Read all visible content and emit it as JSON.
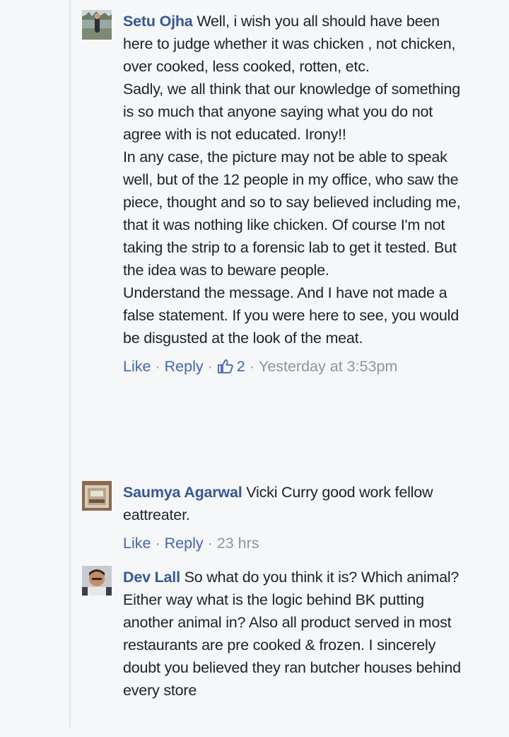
{
  "comments": [
    {
      "author": "Setu Ojha",
      "text": "Well, i wish you all should have been here to judge whether it was chicken , not chicken, over cooked, less cooked, rotten, etc.\nSadly, we all think that our knowledge of something is so much that anyone saying what you do not agree with is not educated. Irony!!\nIn any case, the picture may not be able to speak well, but of the 12 people in my office, who saw the piece, thought and so to say believed including me, that it was nothing like chicken. Of course I'm not taking the strip to a forensic lab to get it tested. But the idea was to beware people.\nUnderstand the message. And I have not made a false statement. If you were here to see, you would be disgusted at the look of the meat.",
      "like_label": "Like",
      "reply_label": "Reply",
      "like_count": "2",
      "timestamp": "Yesterday at 3:53pm"
    },
    {
      "author": "Saumya Agarwal",
      "text": "Vicki Curry good work fellow eattreater.",
      "like_label": "Like",
      "reply_label": "Reply",
      "timestamp": "23 hrs"
    },
    {
      "author": "Dev Lall",
      "text": "So what do you think it is? Which animal? Either way what is the logic behind BK putting another animal in? Also all product served in most restaurants are pre cooked & frozen. I sincerely doubt you believed they ran butcher houses behind every store"
    }
  ],
  "colors": {
    "author": "#365899",
    "link": "#4267b2",
    "meta": "#90949c",
    "background": "#f6f7f9"
  },
  "icons": {
    "like_count_icon": "thumbs-up-icon"
  }
}
